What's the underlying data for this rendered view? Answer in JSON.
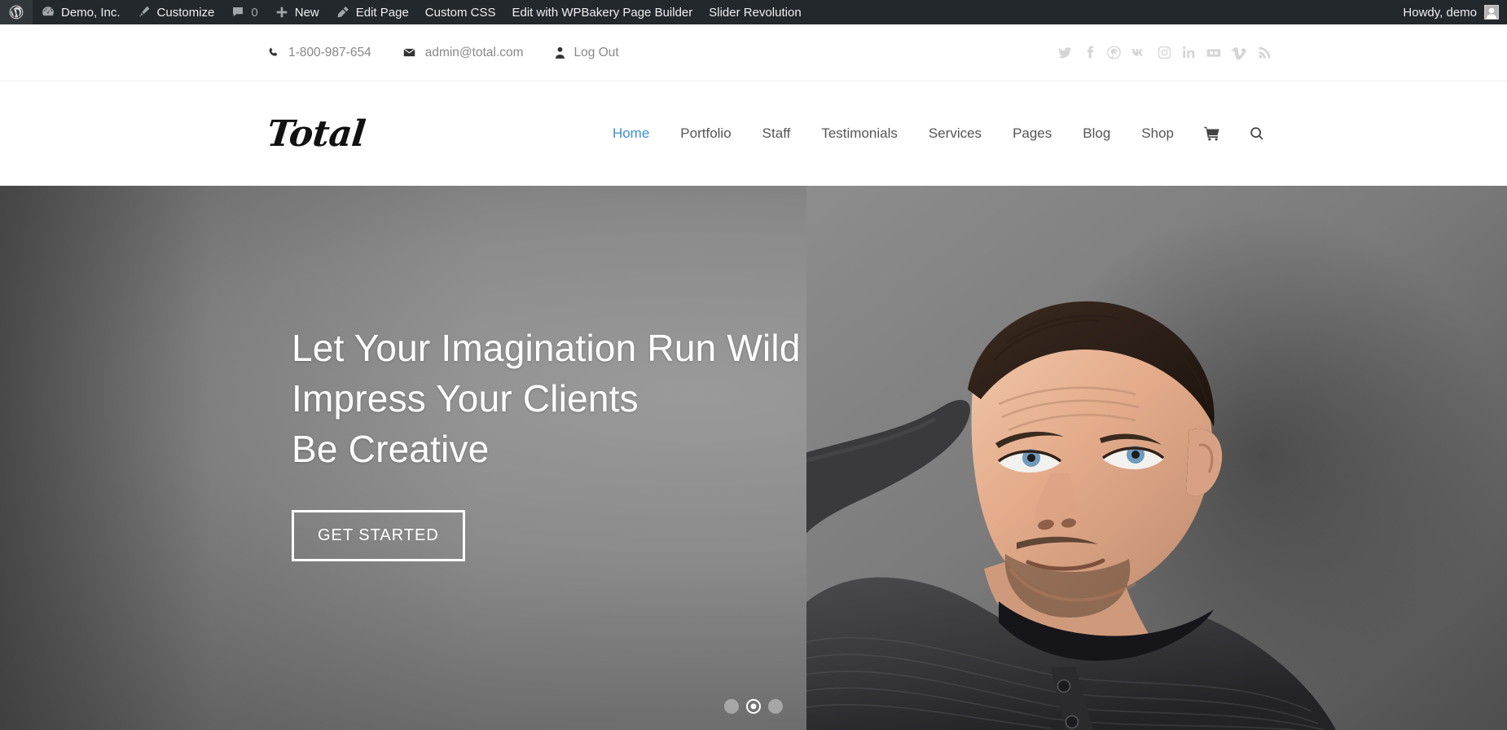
{
  "admin_bar": {
    "wp_logo_icon": "wordpress-logo-icon",
    "items": [
      {
        "label": "Demo, Inc.",
        "icon": "dashboard-icon",
        "name": "site-name"
      },
      {
        "label": "Customize",
        "icon": "paintbrush-icon",
        "name": "customize"
      },
      {
        "label": "0",
        "icon": "comment-bubble-icon",
        "name": "comments"
      },
      {
        "label": "New",
        "icon": "plus-icon",
        "name": "new-content"
      },
      {
        "label": "Edit Page",
        "icon": "pencil-icon",
        "name": "edit-page"
      },
      {
        "label": "Custom CSS",
        "icon": "",
        "name": "custom-css"
      },
      {
        "label": "Edit with WPBakery Page Builder",
        "icon": "",
        "name": "wpbakery"
      },
      {
        "label": "Slider Revolution",
        "icon": "",
        "name": "slider-revolution"
      }
    ],
    "howdy": "Howdy, demo",
    "avatar_icon": "user-avatar-icon",
    "background_color": "#23282d",
    "text_color": "#eeeeee"
  },
  "top_bar": {
    "phone": "1-800-987-654",
    "phone_icon": "phone-icon",
    "email": "admin@total.com",
    "email_icon": "envelope-icon",
    "logout": "Log Out",
    "logout_icon": "user-icon",
    "social": [
      {
        "name": "twitter-icon",
        "title": "Twitter"
      },
      {
        "name": "facebook-icon",
        "title": "Facebook"
      },
      {
        "name": "pinterest-icon",
        "title": "Pinterest"
      },
      {
        "name": "vk-icon",
        "title": "VK"
      },
      {
        "name": "instagram-icon",
        "title": "Instagram"
      },
      {
        "name": "linkedin-icon",
        "title": "LinkedIn"
      },
      {
        "name": "flickr-icon",
        "title": "Flickr"
      },
      {
        "name": "vimeo-icon",
        "title": "Vimeo"
      },
      {
        "name": "rss-icon",
        "title": "RSS"
      }
    ]
  },
  "header": {
    "logo_text": "Total",
    "nav": [
      {
        "label": "Home",
        "active": true
      },
      {
        "label": "Portfolio",
        "active": false
      },
      {
        "label": "Staff",
        "active": false
      },
      {
        "label": "Testimonials",
        "active": false
      },
      {
        "label": "Services",
        "active": false
      },
      {
        "label": "Pages",
        "active": false
      },
      {
        "label": "Blog",
        "active": false
      },
      {
        "label": "Shop",
        "active": false
      }
    ],
    "cart_icon": "shopping-cart-icon",
    "search_icon": "search-icon",
    "active_link_color": "#3b8fdc",
    "link_color": "#555555"
  },
  "hero": {
    "lines": [
      "Let Your Imagination Run Wild",
      "Impress Your Clients",
      "Be Creative"
    ],
    "cta_label": "GET STARTED",
    "photo_alt": "man-looking-up-photo",
    "slides": [
      {
        "index": 1,
        "active": false
      },
      {
        "index": 2,
        "active": true
      },
      {
        "index": 3,
        "active": false
      }
    ],
    "text_color": "#ffffff"
  }
}
